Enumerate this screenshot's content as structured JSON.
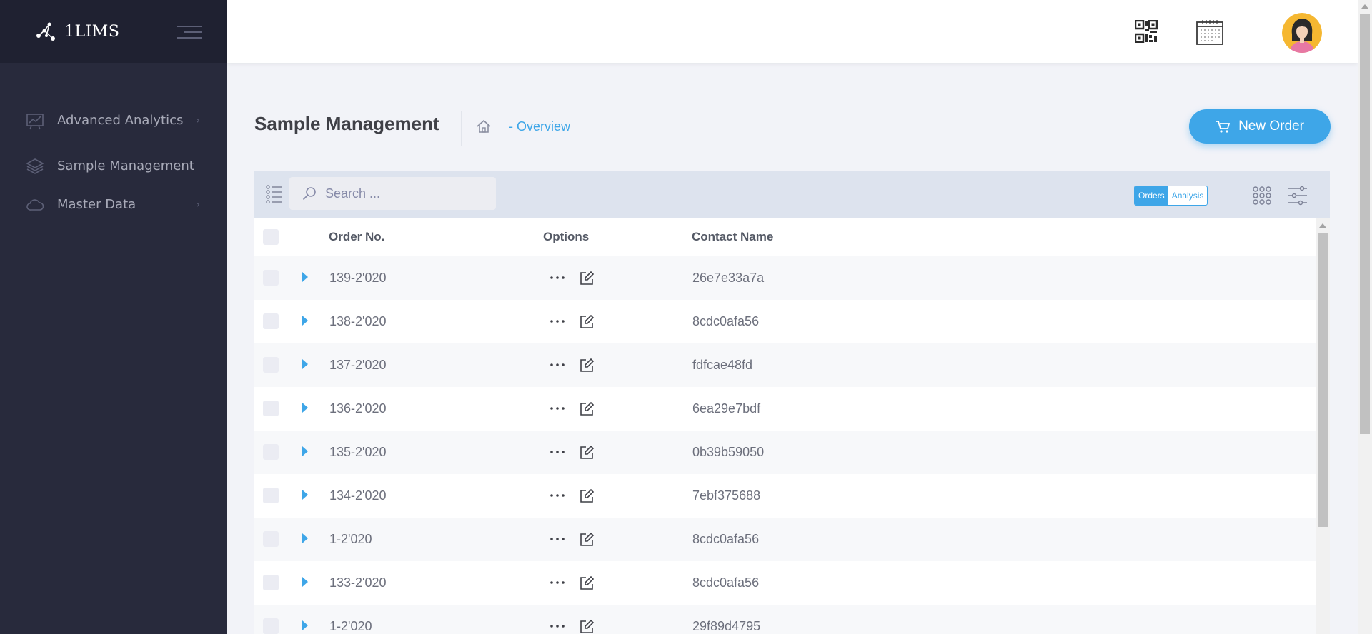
{
  "brand": {
    "name": "1LIMS"
  },
  "sidebar": {
    "items": [
      {
        "label": "Advanced Analytics",
        "icon": "analytics-chart-icon",
        "has_arrow": true
      },
      {
        "label": "Sample Management",
        "icon": "layers-icon",
        "has_arrow": false
      },
      {
        "label": "Master Data",
        "icon": "cloud-icon",
        "has_arrow": true
      }
    ]
  },
  "header": {
    "qr_icon": "qr-code-icon",
    "calendar_icon": "calendar-icon",
    "avatar": "user-avatar"
  },
  "subheader": {
    "title": "Sample Management",
    "breadcrumb": "- Overview",
    "new_order_label": "New Order"
  },
  "toolbar": {
    "search_placeholder": "Search ...",
    "toggle_orders": "Orders",
    "toggle_analysis": "Analysis",
    "active_toggle": "Orders"
  },
  "table": {
    "columns": {
      "order_no": "Order No.",
      "options": "Options",
      "contact_name": "Contact Name"
    },
    "rows": [
      {
        "order": "139-2'020",
        "contact": "26e7e33a7a"
      },
      {
        "order": "138-2'020",
        "contact": "8cdc0afa56"
      },
      {
        "order": "137-2'020",
        "contact": "fdfcae48fd"
      },
      {
        "order": "136-2'020",
        "contact": "6ea29e7bdf"
      },
      {
        "order": "135-2'020",
        "contact": "0b39b59050"
      },
      {
        "order": "134-2'020",
        "contact": "7ebf375688"
      },
      {
        "order": "1-2'020",
        "contact": "8cdc0afa56"
      },
      {
        "order": "133-2'020",
        "contact": "8cdc0afa56"
      },
      {
        "order": "1-2'020",
        "contact": "29f89d4795"
      }
    ]
  },
  "colors": {
    "sidebar_bg": "#282a3c",
    "brand_bg": "#1f2131",
    "accent": "#3ea6e8",
    "page_bg": "#f2f3f8",
    "toolbar_bg": "#dde3ee"
  }
}
